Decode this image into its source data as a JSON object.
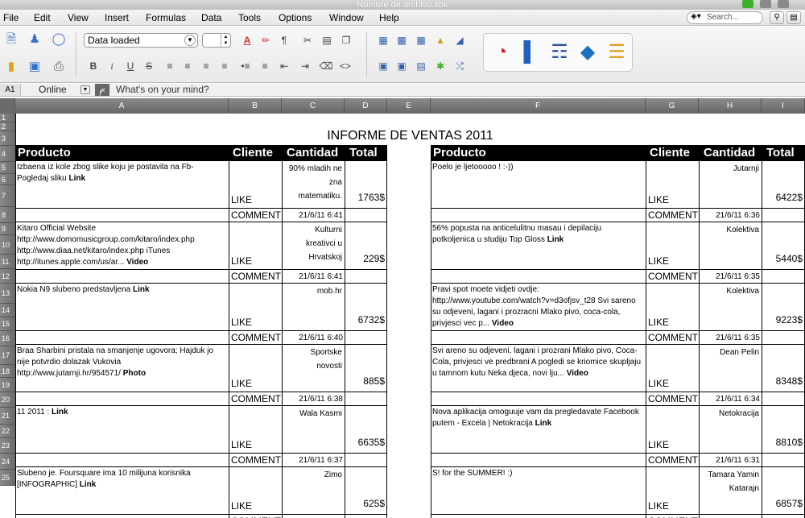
{
  "window": {
    "title": "Nombre de archivo.xbk"
  },
  "menu": [
    "File",
    "Edit",
    "View",
    "Insert",
    "Formulas",
    "Data",
    "Tools",
    "Options",
    "Window",
    "Help"
  ],
  "search": {
    "placeholder": "Search..."
  },
  "toolbar": {
    "status_dropdown": "Data loaded",
    "icons_left": [
      "new-doc-icon",
      "users-icon",
      "chat-icon",
      "folder-icon",
      "save-icon",
      "print-icon"
    ],
    "format_icons_row1": [
      "font-color-icon",
      "highlight-icon",
      "pilcrow-icon",
      "cut-icon",
      "paste-icon",
      "copy-icon"
    ],
    "format_icons_row2": [
      "bold-icon",
      "italic-icon",
      "underline-icon",
      "strikethrough-icon",
      "justify-icon",
      "align-left-icon",
      "align-center-icon",
      "align-right-icon",
      "bullet-list-icon",
      "numbered-list-icon",
      "outdent-icon",
      "indent-icon",
      "eraser-icon",
      "code-icon"
    ],
    "table_icons": [
      "table-icon",
      "calendar-icon",
      "grid-icon",
      "image-icon",
      "chart-small-icon",
      "picture-icon",
      "frame-icon",
      "slides-icon",
      "puzzle-icon",
      "shuffle-icon"
    ],
    "chart_icons": [
      "pie-chart-icon",
      "bar-chart-icon",
      "line-chart-icon",
      "shapes-icon",
      "database-icon"
    ]
  },
  "formula_bar": {
    "cell_ref": "A1",
    "sheet": "Online",
    "fx": "f",
    "content": "What's on your mind?"
  },
  "columns": [
    "A",
    "B",
    "C",
    "D",
    "E",
    "F",
    "G",
    "H",
    "I"
  ],
  "rows": [
    "1",
    "2",
    "3",
    "4",
    "5",
    "6",
    "7",
    "8",
    "9",
    "10",
    "11",
    "12",
    "13",
    "14",
    "15",
    "16",
    "17",
    "18",
    "19",
    "20",
    "21",
    "22",
    "23",
    "24",
    "25"
  ],
  "report": {
    "title": "INFORME DE VENTAS 2011",
    "headers": {
      "producto": "Producto",
      "cliente": "Cliente",
      "cantidad": "Cantidad",
      "total": "Total"
    },
    "like": "LIKE",
    "comment": "COMMENT",
    "left": [
      {
        "text": "Izbaena iz kole zbog slike koju je postavila na Fb- Pogledaj sliku ",
        "tag": "Link",
        "source": "90% mladih ne zna matematiku.",
        "total": "1763$",
        "time": "21/6/11 6:41"
      },
      {
        "text": "Kitaro Official Website http://www.domomusicgroup.com/kitaro/index.php http://www.diaa.net/kitaro/index.php iTunes http://itunes.apple.com/us/ar... ",
        "tag": "Video",
        "source": "Kulturni kreativci u Hrvatskoj",
        "total": "229$",
        "time": "21/6/11 6:41"
      },
      {
        "text": "Nokia N9 slubeno predstavljena ",
        "tag": "Link",
        "source": "mob.hr",
        "total": "6732$",
        "time": "21/6/11 6:40"
      },
      {
        "text": "Braa Sharbini pristala na smanjenje ugovora; Hajduk jo nije potvrdio dolazak Vukovia http://www.jutarnji.hr/954571/ ",
        "tag": "Photo",
        "source": "Sportske novosti",
        "total": "885$",
        "time": "21/6/11 6:38"
      },
      {
        "text": "11 2011 :     ",
        "tag": "Link",
        "source": "Wala Kasmi",
        "total": "6635$",
        "time": "21/6/11 6:37"
      },
      {
        "text": "Slubeno je. Foursquare ima 10 milijuna korisnika [INFOGRAPHIC] ",
        "tag": "Link",
        "source": "Zimo",
        "total": "625$",
        "time": ""
      }
    ],
    "right": [
      {
        "text": "Poelo je ljetooooo ! :-))",
        "tag": "",
        "source": "Jutarnji",
        "total": "6422$",
        "time": "21/6/11 6:36"
      },
      {
        "text": "56% popusta na anticelulitnu masau i depilaciju potkoljenica u studiju Top Gloss ",
        "tag": "Link",
        "source": "Kolektiva",
        "total": "5440$",
        "time": "21/6/11 6:35"
      },
      {
        "text": "Pravi spot moete vidjeti ovdje: http://www.youtube.com/watch?v=d3ofjsv_t28 Svi sareno su odjeveni, lagani i prozracni Mlako pivo, coca-cola, privjesci vec p... ",
        "tag": "Video",
        "source": "Kolektiva",
        "total": "9223$",
        "time": "21/6/11 6:35"
      },
      {
        "text": "Svi areno su odjeveni, lagani i prozrani Mlako pivo, Coca-Cola, privjesci ve predbrani A pogledi se kriomice skupljaju u tamnom kutu Neka djeca, novi lju... ",
        "tag": "Video",
        "source": "Dean Pelin",
        "total": "8348$",
        "time": "21/6/11 6:34"
      },
      {
        "text": "Nova aplikacija omoguuje vam da pregledavate Facebook putem - Excela  | Netokracija ",
        "tag": "Link",
        "source": "Netokracija",
        "total": "8810$",
        "time": "21/6/11 6:31"
      },
      {
        "text": "S! for the SUMMER! :)",
        "tag": "",
        "source": "Tamara Yamin Katarajn",
        "total": "6857$",
        "time": ""
      }
    ]
  },
  "colors": {
    "header_bg": "#000000",
    "header_text": "#ffffff",
    "accent_green": "#3fae2a"
  }
}
